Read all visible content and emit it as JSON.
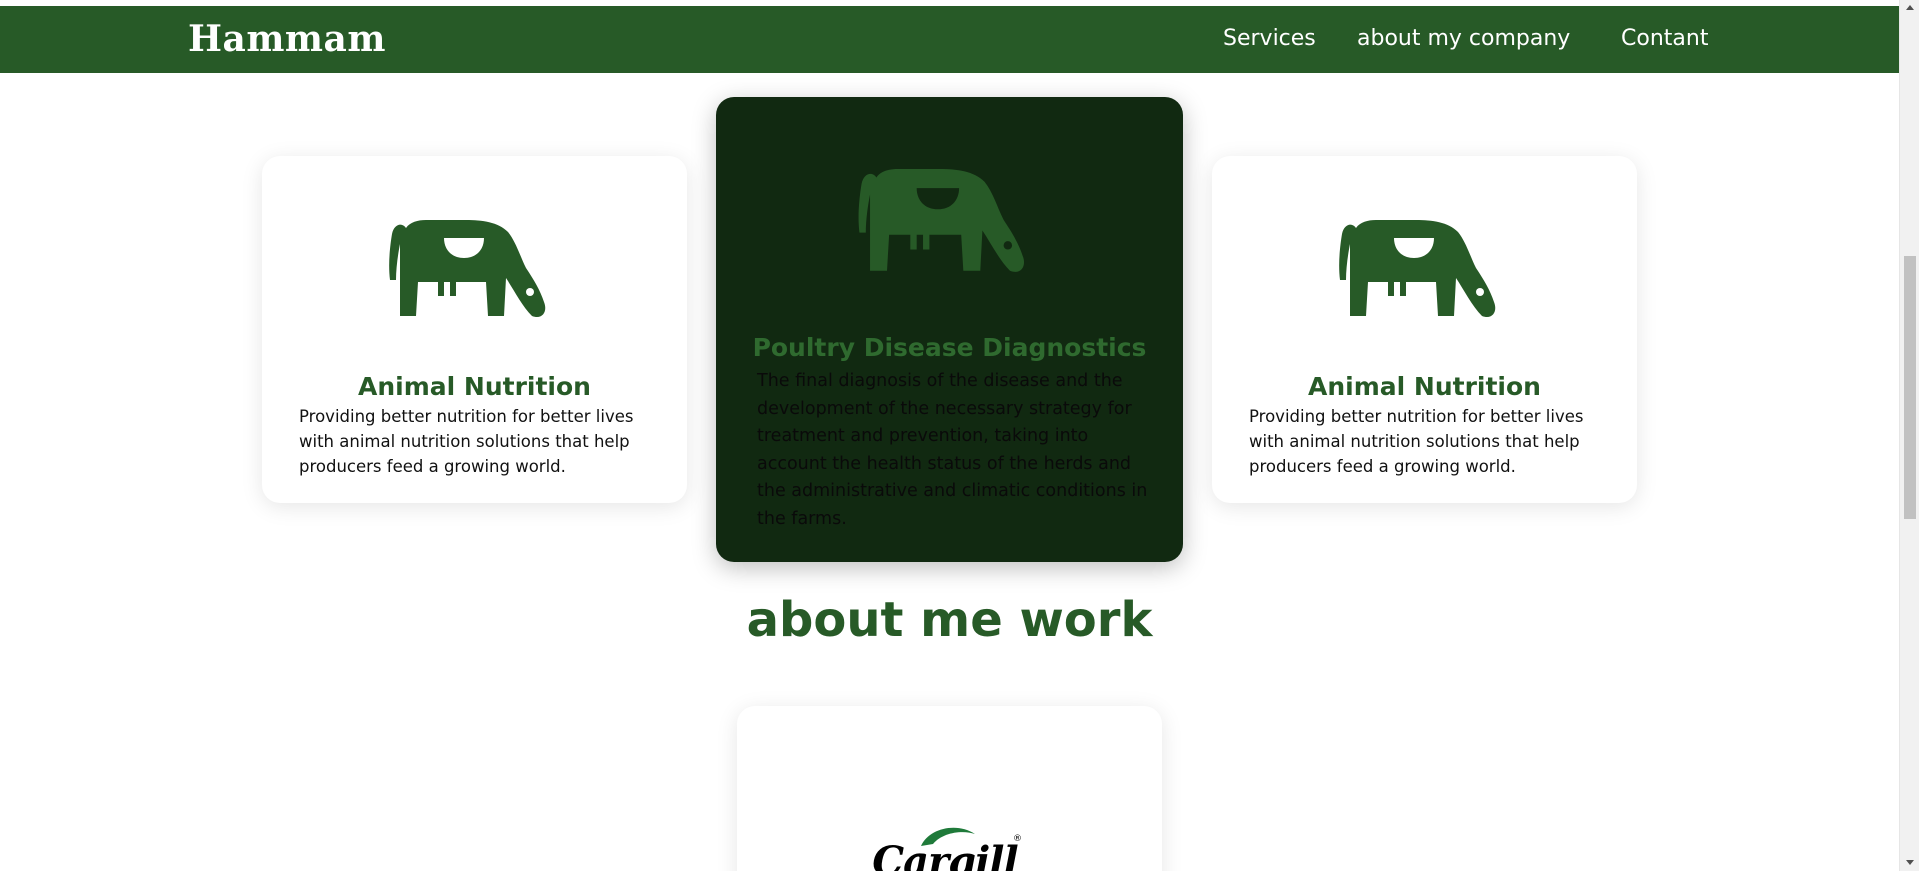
{
  "header": {
    "brand": "Hammam",
    "nav": {
      "services": "Services",
      "about": "about my company",
      "contact": "Contant"
    }
  },
  "cards": [
    {
      "icon": "cow-icon",
      "title": "Animal Nutrition",
      "text": "Providing better nutrition for better lives with animal nutrition solutions that help producers feed a growing world."
    },
    {
      "icon": "cow-icon",
      "title": "Poultry Disease Diagnostics",
      "text": "The final diagnosis of the disease and the development of the necessary strategy for treatment and prevention, taking into account the health status of the herds and the administrative and climatic conditions in the farms."
    },
    {
      "icon": "cow-icon",
      "title": "Animal Nutrition",
      "text": "Providing better nutrition for better lives with animal nutrition solutions that help producers feed a growing world."
    }
  ],
  "work": {
    "heading": "about me work",
    "logo_text": "Cargill",
    "logo_mark": "®"
  },
  "colors": {
    "brand_green": "#275a27",
    "highlight_card": "#112911",
    "icon_green": "#275a27"
  }
}
